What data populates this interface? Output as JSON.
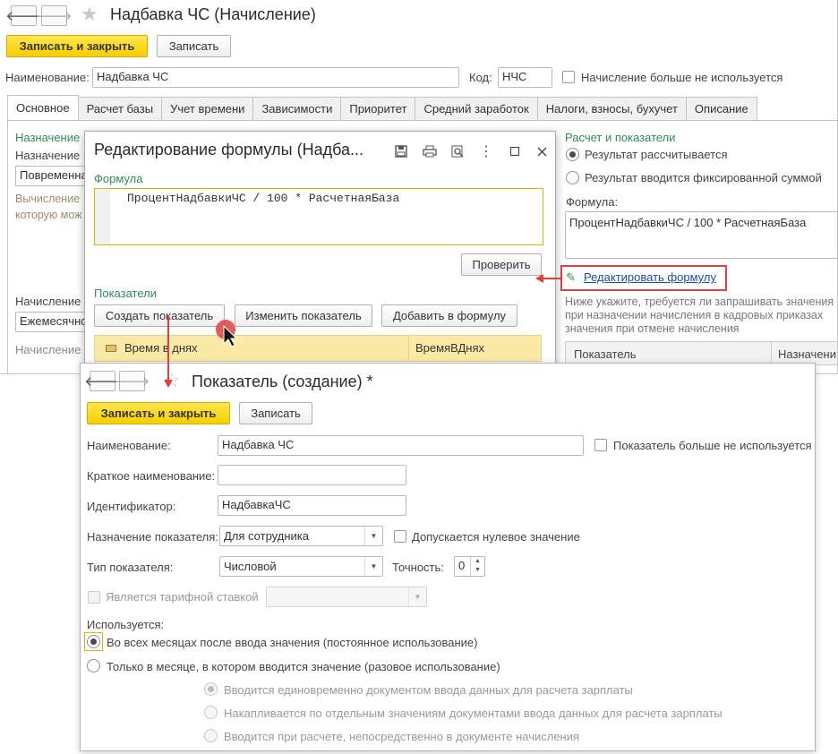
{
  "main_window": {
    "title": "Надбавка ЧС (Начисление)",
    "save_close": "Записать и закрыть",
    "save": "Записать",
    "name_label": "Наименование:",
    "name_value": "Надбавка ЧС",
    "code_label": "Код:",
    "code_value": "НЧС",
    "not_used_label": "Начисление больше не используется",
    "tabs": [
      {
        "label": "Основное"
      },
      {
        "label": "Расчет базы"
      },
      {
        "label": "Учет времени"
      },
      {
        "label": "Зависимости"
      },
      {
        "label": "Приоритет"
      },
      {
        "label": "Средний заработок"
      },
      {
        "label": "Налоги, взносы, бухучет"
      },
      {
        "label": "Описание"
      }
    ],
    "left": {
      "section": "Назначение",
      "assign_label": "Назначение",
      "assign_value": "Повременная",
      "calc_text_1": "Вычисление",
      "calc_text_2": "которую мож",
      "accrual_label": "Начисление",
      "accrual_value": "Ежемесячно",
      "accrual_label2": "Начисление"
    },
    "right": {
      "section": "Расчет и показатели",
      "radio_calc": "Результат рассчитывается",
      "radio_fixed": "Результат вводится фиксированной суммой",
      "formula_label": "Формула:",
      "formula_value": "ПроцентНадбавкиЧС / 100 * РасчетнаяБаза",
      "edit_formula": "Редактировать формулу",
      "hint_1": "Ниже укажите, требуется ли запрашивать значения",
      "hint_2": "при назначении начисления в кадровых приказах",
      "hint_3": "значения при отмене начисления",
      "col_indicator": "Показатель",
      "col_assign": "Назначени"
    }
  },
  "formula_dialog": {
    "title": "Редактирование формулы (Надба...",
    "formula_section": "Формула",
    "formula_text": "ПроцентНадбавкиЧС / 100 * РасчетнаяБаза",
    "check_button": "Проверить",
    "indicators_section": "Показатели",
    "create_button": "Создать показатель",
    "change_button": "Изменить показатель",
    "add_button": "Добавить в формулу",
    "row_name": "Время в днях",
    "row_id": "ВремяВДнях"
  },
  "indicator_window": {
    "title": "Показатель (создание) *",
    "save_close": "Записать и закрыть",
    "save": "Записать",
    "name_label": "Наименование:",
    "name_value": "Надбавка ЧС",
    "not_used_label": "Показатель больше не используется",
    "short_label": "Краткое наименование:",
    "short_value": "",
    "id_label": "Идентификатор:",
    "id_value": "НадбавкаЧС",
    "purpose_label": "Назначение показателя:",
    "purpose_value": "Для сотрудника",
    "zero_label": "Допускается нулевое значение",
    "type_label": "Тип показателя:",
    "type_value": "Числовой",
    "precision_label": "Точность:",
    "precision_value": "0",
    "tariff_label": "Является тарифной ставкой",
    "used_label": "Используется:",
    "radio_all": "Во всех месяцах после ввода значения (постоянное использование)",
    "radio_once": "Только в месяце, в котором вводится значение (разовое использование)",
    "sub_1": "Вводится единовременно документом ввода данных для расчета зарплаты",
    "sub_2": "Накапливается по отдельным значениям документами ввода данных для расчета зарплаты",
    "sub_3": "Вводится при расчете, непосредственно в документе начисления"
  },
  "colors": {
    "accent_yellow": "#f7cf00",
    "highlight_red": "#e04040",
    "section_green": "#2e8b57",
    "link_blue": "#1a4fa0",
    "row_yellow": "#fbe9a6"
  }
}
